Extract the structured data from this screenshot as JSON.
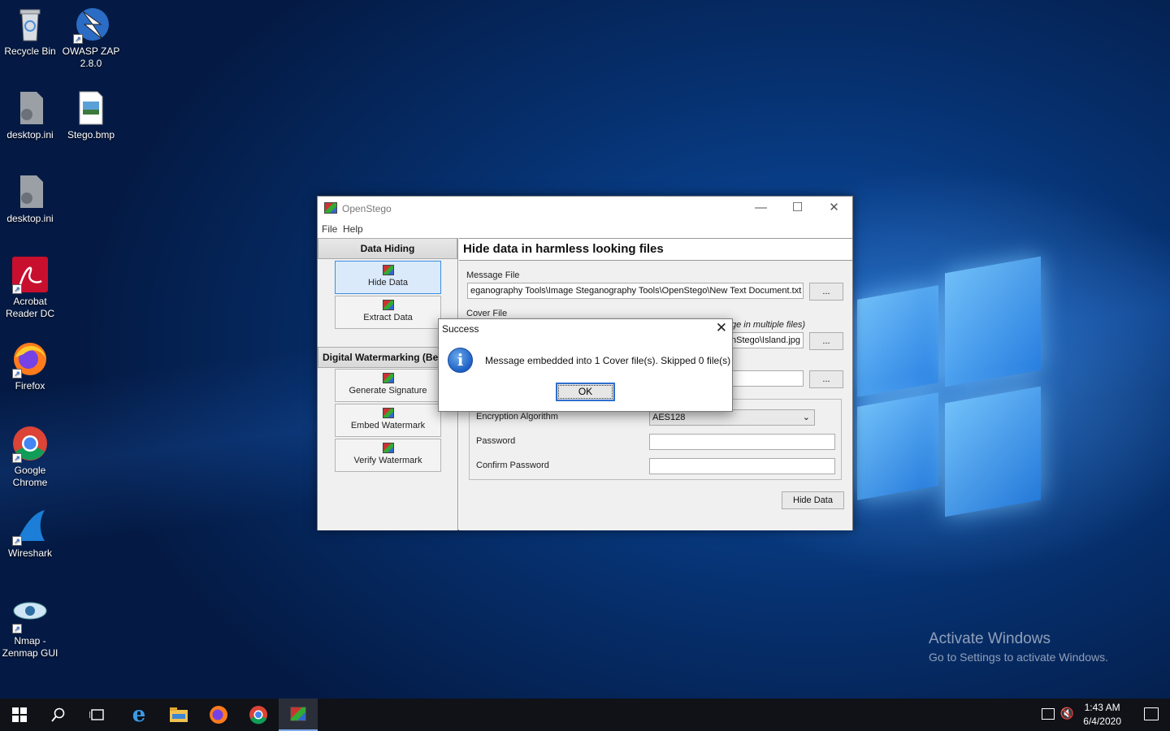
{
  "desktop": {
    "icons": [
      {
        "label": "Recycle Bin",
        "icon": "recycle-bin-icon"
      },
      {
        "label": "OWASP ZAP 2.8.0",
        "line1": "OWASP ZAP",
        "line2": "2.8.0",
        "icon": "owasp-zap-icon"
      },
      {
        "label": "desktop.ini",
        "icon": "settings-file-icon"
      },
      {
        "label": "Stego.bmp",
        "icon": "bitmap-file-icon"
      },
      {
        "label": "desktop.ini",
        "icon": "settings-file-icon"
      },
      {
        "label": "Acrobat Reader DC",
        "line1": "Acrobat",
        "line2": "Reader DC",
        "icon": "acrobat-icon"
      },
      {
        "label": "Firefox",
        "icon": "firefox-icon"
      },
      {
        "label": "Google Chrome",
        "line1": "Google",
        "line2": "Chrome",
        "icon": "chrome-icon"
      },
      {
        "label": "Wireshark",
        "icon": "wireshark-icon"
      },
      {
        "label": "Nmap - Zenmap GUI",
        "line1": "Nmap -",
        "line2": "Zenmap GUI",
        "icon": "zenmap-icon"
      }
    ]
  },
  "watermark": {
    "title": "Activate Windows",
    "subtitle": "Go to Settings to activate Windows."
  },
  "taskbar": {
    "buttons": [
      "start-icon",
      "search-icon",
      "task-view-icon",
      "edge-icon",
      "file-explorer-icon",
      "firefox-icon",
      "chrome-icon",
      "openstego-icon"
    ],
    "time": "1:43 AM",
    "date": "6/4/2020"
  },
  "window": {
    "title": "OpenStego",
    "menu": [
      "File",
      "Help"
    ],
    "left": {
      "section1": "Data Hiding",
      "hide_data": "Hide Data",
      "extract_data": "Extract Data",
      "section2": "Digital Watermarking (Be",
      "generate_signature": "Generate Signature",
      "embed_watermark": "Embed Watermark",
      "verify_watermark": "Verify Watermark"
    },
    "main": {
      "heading": "Hide data in harmless looking files",
      "message_file_label": "Message File",
      "message_file_value": "eganography Tools\\Image Steganography Tools\\OpenStego\\New Text Document.txt",
      "browse": "...",
      "cover_file_label": "Cover File",
      "cover_hint": "ge in multiple files)",
      "cover_file_value": "nStego\\Island.jpg",
      "output_value": "",
      "encryption_label": "Encryption Algorithm",
      "encryption_value": "AES128",
      "password_label": "Password",
      "confirm_label": "Confirm Password",
      "hide_button": "Hide Data"
    }
  },
  "dialog": {
    "title": "Success",
    "message": "Message embedded into 1 Cover file(s). Skipped 0 file(s)",
    "ok": "OK"
  }
}
